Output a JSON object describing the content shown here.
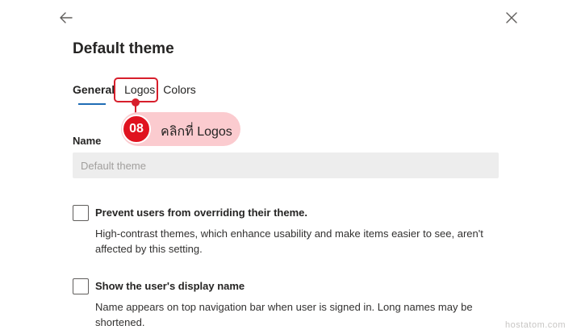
{
  "header": {
    "title": "Default theme",
    "back_icon": "arrow-left",
    "close_icon": "close-x"
  },
  "tabs": [
    {
      "label": "General",
      "active": true
    },
    {
      "label": "Logos",
      "active": false
    },
    {
      "label": "Colors",
      "active": false
    }
  ],
  "callout": {
    "step": "08",
    "text": "คลิกที่ Logos"
  },
  "name_field": {
    "label": "Name",
    "placeholder": "Default theme",
    "value": ""
  },
  "options": [
    {
      "title": "Prevent users from overriding their theme.",
      "description": "High-contrast themes, which enhance usability and make items easier to see, aren't affected by this setting.",
      "checked": false
    },
    {
      "title": "Show the user's display name",
      "description": "Name appears on top navigation bar when user is signed in. Long names may be shortened.",
      "checked": false
    }
  ],
  "watermark": "hostatom.com",
  "colors": {
    "accent_underline": "#1f6db5",
    "annotation_red": "#d71f2c",
    "callout_bg": "#fbcbcf"
  }
}
